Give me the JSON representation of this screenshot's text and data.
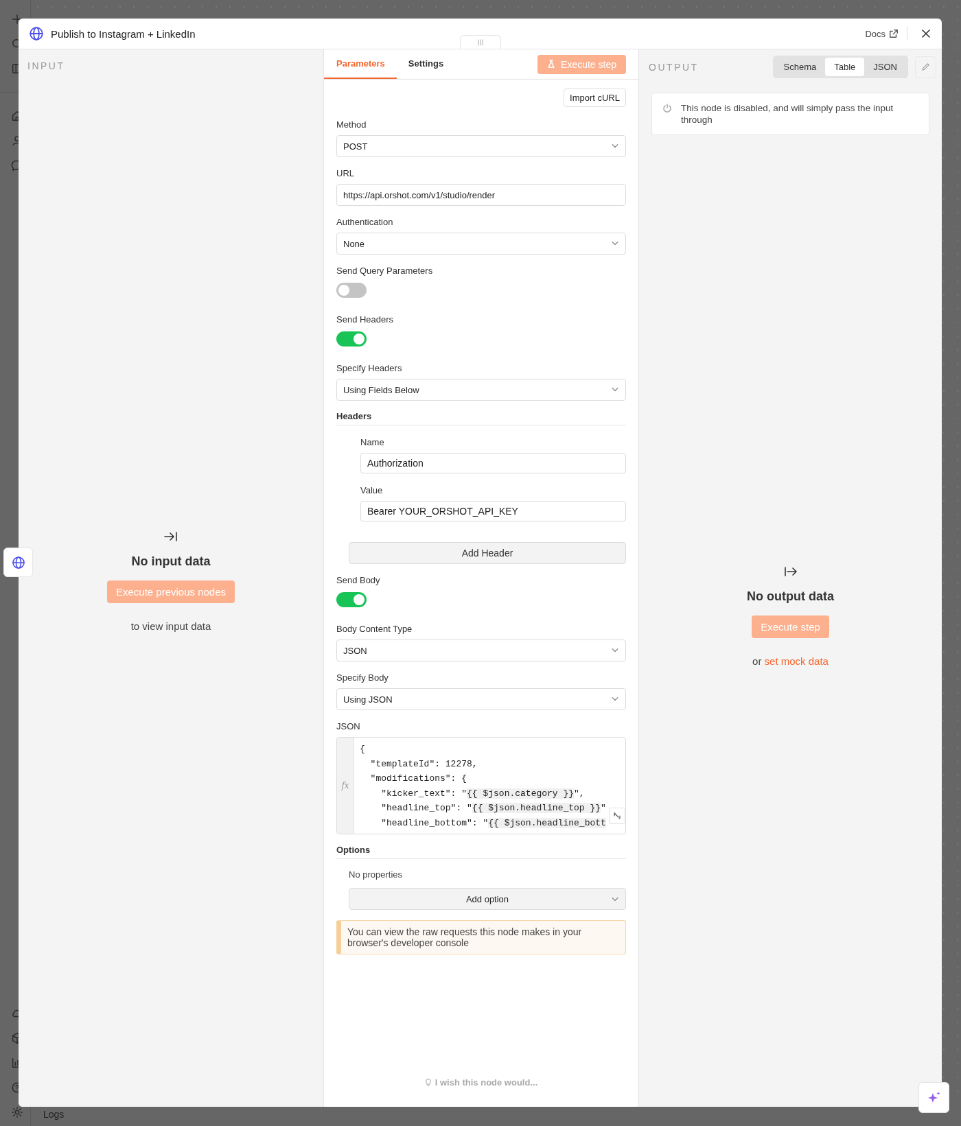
{
  "sidebar": {
    "items": [
      {
        "kind": "add"
      },
      {
        "kind": "search"
      },
      {
        "kind": "panel"
      },
      {
        "kind": "home"
      },
      {
        "kind": "people"
      },
      {
        "kind": "chat"
      }
    ],
    "bottom_items": [
      {
        "kind": "cloud"
      },
      {
        "kind": "box"
      },
      {
        "kind": "chart"
      },
      {
        "kind": "help"
      },
      {
        "kind": "settings"
      }
    ]
  },
  "bottom_bar": {
    "label": "Logs"
  },
  "window": {
    "title": "Publish to Instagram + LinkedIn",
    "docs_link": "Docs"
  },
  "input_panel": {
    "heading": "INPUT",
    "empty_title": "No input data",
    "button": "Execute previous nodes",
    "hint": "to view input data"
  },
  "parameters_panel": {
    "tabs": [
      {
        "label": "Parameters",
        "selected": true
      },
      {
        "label": "Settings",
        "selected": false
      }
    ],
    "execute_button": "Execute step",
    "import_button": "Import cURL",
    "fields": [
      {
        "kind": "select",
        "label": "Method",
        "value": "POST"
      },
      {
        "kind": "input",
        "label": "URL",
        "value": "https://api.orshot.com/v1/studio/render"
      },
      {
        "kind": "select",
        "label": "Authentication",
        "value": "None"
      },
      {
        "kind": "toggle",
        "label": "Send Query Parameters",
        "on": false
      },
      {
        "kind": "toggle",
        "label": "Send Headers",
        "on": true
      },
      {
        "kind": "select",
        "label": "Specify Headers",
        "value": "Using Fields Below"
      },
      {
        "kind": "collection",
        "label": "Headers",
        "fields": [
          {
            "label": "Name",
            "value": "Authorization"
          },
          {
            "label": "Value",
            "value": "Bearer YOUR_ORSHOT_API_KEY"
          }
        ],
        "add_button": "Add Header"
      },
      {
        "kind": "toggle",
        "label": "Send Body",
        "on": true
      },
      {
        "kind": "select",
        "label": "Body Content Type",
        "value": "JSON"
      },
      {
        "kind": "select",
        "label": "Specify Body",
        "value": "Using JSON"
      },
      {
        "kind": "code",
        "label": "JSON",
        "gutter": "fx",
        "lines": [
          "{",
          "  \"templateId\": 12278,",
          "  \"modifications\": {",
          "    \"kicker_text\": \"{{ $json.category }}\",",
          "    \"headline_top\": \"{{ $json.headline_top }}\"",
          "    \"headline_bottom\": \"{{ $json.headline_bott"
        ]
      },
      {
        "kind": "options",
        "label": "Options",
        "empty_text": "No properties",
        "add_button": "Add option"
      }
    ],
    "notice": "You can view the raw requests this node makes in your browser's developer console",
    "feedback": "I wish this node would..."
  },
  "output_panel": {
    "heading": "OUTPUT",
    "view_tabs": [
      {
        "label": "Schema",
        "selected": false
      },
      {
        "label": "Table",
        "selected": true
      },
      {
        "label": "JSON",
        "selected": false
      }
    ],
    "notice": "This node is disabled, and will simply pass the input through",
    "empty_title": "No output data",
    "button": "Execute step",
    "hint": "or",
    "hint_link": "set mock data"
  }
}
